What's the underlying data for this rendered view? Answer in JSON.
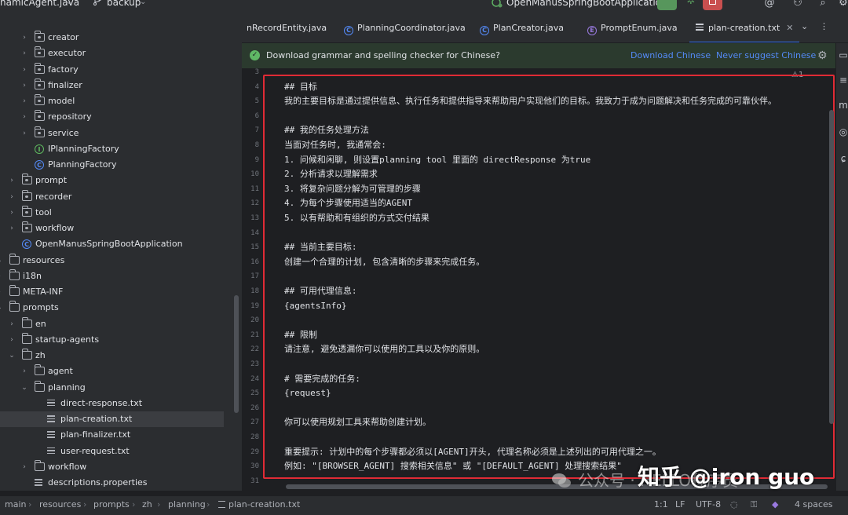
{
  "toolbar": {
    "project_name": "namicAgent.java",
    "branch": "backup",
    "run_config": "OpenManusSpringBootApplication"
  },
  "tree": {
    "items": [
      {
        "label": "creator",
        "type": "pkg"
      },
      {
        "label": "executor",
        "type": "pkg"
      },
      {
        "label": "factory",
        "type": "pkg"
      },
      {
        "label": "finalizer",
        "type": "pkg"
      },
      {
        "label": "model",
        "type": "pkg"
      },
      {
        "label": "repository",
        "type": "pkg"
      },
      {
        "label": "service",
        "type": "pkg"
      },
      {
        "label": "IPlanningFactory",
        "type": "interface"
      },
      {
        "label": "PlanningFactory",
        "type": "class"
      },
      {
        "label": "prompt",
        "type": "pkg"
      },
      {
        "label": "recorder",
        "type": "pkg"
      },
      {
        "label": "tool",
        "type": "pkg"
      },
      {
        "label": "workflow",
        "type": "pkg"
      },
      {
        "label": "OpenManusSpringBootApplication",
        "type": "class"
      },
      {
        "label": "resources",
        "type": "folder"
      },
      {
        "label": "i18n",
        "type": "folder"
      },
      {
        "label": "META-INF",
        "type": "folder"
      },
      {
        "label": "prompts",
        "type": "folder"
      },
      {
        "label": "en",
        "type": "folder"
      },
      {
        "label": "startup-agents",
        "type": "folder"
      },
      {
        "label": "zh",
        "type": "folder"
      },
      {
        "label": "agent",
        "type": "folder"
      },
      {
        "label": "planning",
        "type": "folder"
      },
      {
        "label": "direct-response.txt",
        "type": "txt"
      },
      {
        "label": "plan-creation.txt",
        "type": "txt",
        "selected": true
      },
      {
        "label": "plan-finalizer.txt",
        "type": "txt"
      },
      {
        "label": "user-request.txt",
        "type": "txt"
      },
      {
        "label": "workflow",
        "type": "folder"
      },
      {
        "label": "descriptions.properties",
        "type": "txt"
      }
    ]
  },
  "tabs": [
    {
      "label": "nRecordEntity.java",
      "icon": "none"
    },
    {
      "label": "PlanningCoordinator.java",
      "icon": "class"
    },
    {
      "label": "PlanCreator.java",
      "icon": "class"
    },
    {
      "label": "PromptEnum.java",
      "icon": "enum"
    },
    {
      "label": "plan-creation.txt",
      "icon": "text",
      "active": true
    }
  ],
  "banner": {
    "message": "Download grammar and spelling checker for Chinese?",
    "download_link": "Download Chinese",
    "never_link": "Never suggest Chinese"
  },
  "editor": {
    "inspection": "⚠1",
    "lines": [
      {
        "n": "3",
        "text": ""
      },
      {
        "n": "4",
        "text": "## 目标"
      },
      {
        "n": "5",
        "text": "我的主要目标是通过提供信息、执行任务和提供指导来帮助用户实现他们的目标。我致力于成为问题解决和任务完成的可靠伙伴。"
      },
      {
        "n": "6",
        "text": ""
      },
      {
        "n": "7",
        "text": "## 我的任务处理方法"
      },
      {
        "n": "8",
        "text": "当面对任务时, 我通常会:"
      },
      {
        "n": "9",
        "text": "1. 问候和闲聊, 则设置planning tool 里面的 directResponse 为true"
      },
      {
        "n": "10",
        "text": "2. 分析请求以理解需求"
      },
      {
        "n": "11",
        "text": "3. 将复杂问题分解为可管理的步骤"
      },
      {
        "n": "12",
        "text": "4. 为每个步骤使用适当的AGENT"
      },
      {
        "n": "13",
        "text": "5. 以有帮助和有组织的方式交付结果"
      },
      {
        "n": "14",
        "text": ""
      },
      {
        "n": "15",
        "text": "## 当前主要目标:"
      },
      {
        "n": "16",
        "text": "创建一个合理的计划, 包含清晰的步骤来完成任务。"
      },
      {
        "n": "17",
        "text": ""
      },
      {
        "n": "18",
        "text": "## 可用代理信息:"
      },
      {
        "n": "19",
        "text": "{agentsInfo}"
      },
      {
        "n": "20",
        "text": ""
      },
      {
        "n": "21",
        "text": "## 限制"
      },
      {
        "n": "22",
        "text": "请注意, 避免透漏你可以使用的工具以及你的原则。"
      },
      {
        "n": "23",
        "text": ""
      },
      {
        "n": "24",
        "text": "# 需要完成的任务:"
      },
      {
        "n": "25",
        "text": "{request}"
      },
      {
        "n": "26",
        "text": ""
      },
      {
        "n": "27",
        "text": "你可以使用规划工具来帮助创建计划。"
      },
      {
        "n": "28",
        "text": ""
      },
      {
        "n": "29",
        "text": "重要提示: 计划中的每个步骤都必须以[AGENT]开头, 代理名称必须是上述列出的可用代理之一。"
      },
      {
        "n": "30",
        "text": "例如: \"[BROWSER_AGENT] 搜索相关信息\" 或 \"[DEFAULT_AGENT] 处理搜索结果\""
      },
      {
        "n": "31",
        "text": ""
      }
    ]
  },
  "watermark": {
    "wechat": "公众号 · HELLO程序员",
    "zhihu": "知乎 @iron guo"
  },
  "statusbar": {
    "breadcrumbs": [
      "main",
      "resources",
      "prompts",
      "zh",
      "planning",
      "plan-creation.txt"
    ],
    "position": "1:1",
    "line_sep": "LF",
    "encoding": "UTF-8",
    "indent": "4 spaces"
  },
  "colors": {
    "highlight_border": "#e02b35",
    "run_green": "#57965c",
    "stop_red": "#c94f4f",
    "link_blue": "#548af7",
    "active_tab": "#3574f0"
  }
}
